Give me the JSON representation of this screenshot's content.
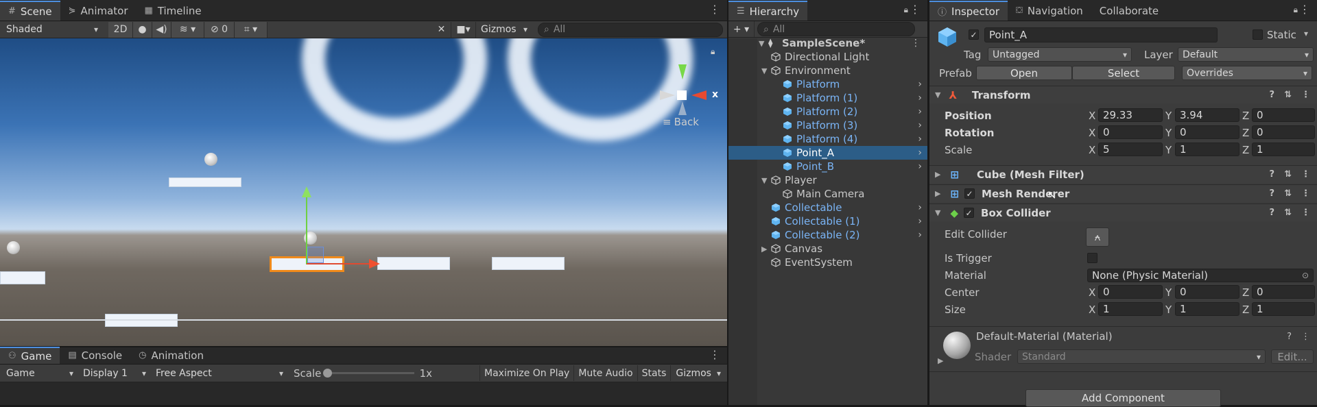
{
  "scene": {
    "tabs": [
      {
        "label": "Scene",
        "icon": "grid-icon"
      },
      {
        "label": "Animator",
        "icon": "animator-icon"
      },
      {
        "label": "Timeline",
        "icon": "timeline-icon"
      }
    ],
    "shading_mode": "Shaded",
    "mode_2d": "2D",
    "hidden_count": "0",
    "gizmos": "Gizmos",
    "search_placeholder": "All",
    "back_label": "Back",
    "axis_x": "x"
  },
  "game": {
    "tabs": [
      {
        "label": "Game",
        "icon": "game-icon"
      },
      {
        "label": "Console",
        "icon": "console-icon"
      },
      {
        "label": "Animation",
        "icon": "animation-icon"
      }
    ],
    "game_dropdown": "Game",
    "display": "Display 1",
    "aspect": "Free Aspect",
    "scale_label": "Scale",
    "scale_value": "1x",
    "maximize": "Maximize On Play",
    "mute": "Mute Audio",
    "stats": "Stats",
    "gizmos": "Gizmos"
  },
  "hierarchy": {
    "tab": "Hierarchy",
    "search_placeholder": "All",
    "items": [
      {
        "label": "SampleScene*",
        "depth": 0,
        "type": "scene",
        "expanded": true
      },
      {
        "label": "Directional Light",
        "depth": 1,
        "type": "object"
      },
      {
        "label": "Environment",
        "depth": 1,
        "type": "object",
        "expanded": true
      },
      {
        "label": "Platform",
        "depth": 2,
        "type": "prefab",
        "chevron": true
      },
      {
        "label": "Platform (1)",
        "depth": 2,
        "type": "prefab",
        "chevron": true
      },
      {
        "label": "Platform (2)",
        "depth": 2,
        "type": "prefab",
        "chevron": true
      },
      {
        "label": "Platform (3)",
        "depth": 2,
        "type": "prefab",
        "chevron": true
      },
      {
        "label": "Platform (4)",
        "depth": 2,
        "type": "prefab",
        "chevron": true
      },
      {
        "label": "Point_A",
        "depth": 2,
        "type": "prefab",
        "chevron": true,
        "selected": true
      },
      {
        "label": "Point_B",
        "depth": 2,
        "type": "prefab",
        "chevron": true
      },
      {
        "label": "Player",
        "depth": 1,
        "type": "object",
        "expanded": true
      },
      {
        "label": "Main Camera",
        "depth": 2,
        "type": "object"
      },
      {
        "label": "Collectable",
        "depth": 1,
        "type": "prefab",
        "chevron": true
      },
      {
        "label": "Collectable (1)",
        "depth": 1,
        "type": "prefab",
        "chevron": true
      },
      {
        "label": "Collectable (2)",
        "depth": 1,
        "type": "prefab",
        "chevron": true
      },
      {
        "label": "Canvas",
        "depth": 1,
        "type": "object",
        "collapsed": true
      },
      {
        "label": "EventSystem",
        "depth": 1,
        "type": "object"
      }
    ]
  },
  "inspector": {
    "tabs": [
      "Inspector",
      "Navigation",
      "Collaborate"
    ],
    "object_name": "Point_A",
    "static_label": "Static",
    "tag_label": "Tag",
    "tag_value": "Untagged",
    "layer_label": "Layer",
    "layer_value": "Default",
    "prefab_label": "Prefab",
    "open": "Open",
    "select": "Select",
    "overrides": "Overrides",
    "transform": {
      "title": "Transform",
      "position_label": "Position",
      "position": {
        "x": "29.33",
        "y": "3.94",
        "z": "0"
      },
      "rotation_label": "Rotation",
      "rotation": {
        "x": "0",
        "y": "0",
        "z": "0"
      },
      "scale_label": "Scale",
      "scale": {
        "x": "5",
        "y": "1",
        "z": "1"
      }
    },
    "mesh_filter": "Cube (Mesh Filter)",
    "mesh_renderer": "Mesh Renderer",
    "box_collider": {
      "title": "Box Collider",
      "edit_collider": "Edit Collider",
      "is_trigger": "Is Trigger",
      "material_label": "Material",
      "material_value": "None (Physic Material)",
      "center_label": "Center",
      "center": {
        "x": "0",
        "y": "0",
        "z": "0"
      },
      "size_label": "Size",
      "size": {
        "x": "1",
        "y": "1",
        "z": "1"
      }
    },
    "material": {
      "title": "Default-Material (Material)",
      "shader_label": "Shader",
      "shader_value": "Standard",
      "edit": "Edit..."
    },
    "add_component": "Add Component",
    "axis_labels": {
      "x": "X",
      "y": "Y",
      "z": "Z"
    }
  },
  "colors": {
    "accent": "#4d8fe0",
    "selection": "#2c5d87",
    "prefab_blue": "#7ab4f5",
    "panel": "#3c3c3c"
  }
}
